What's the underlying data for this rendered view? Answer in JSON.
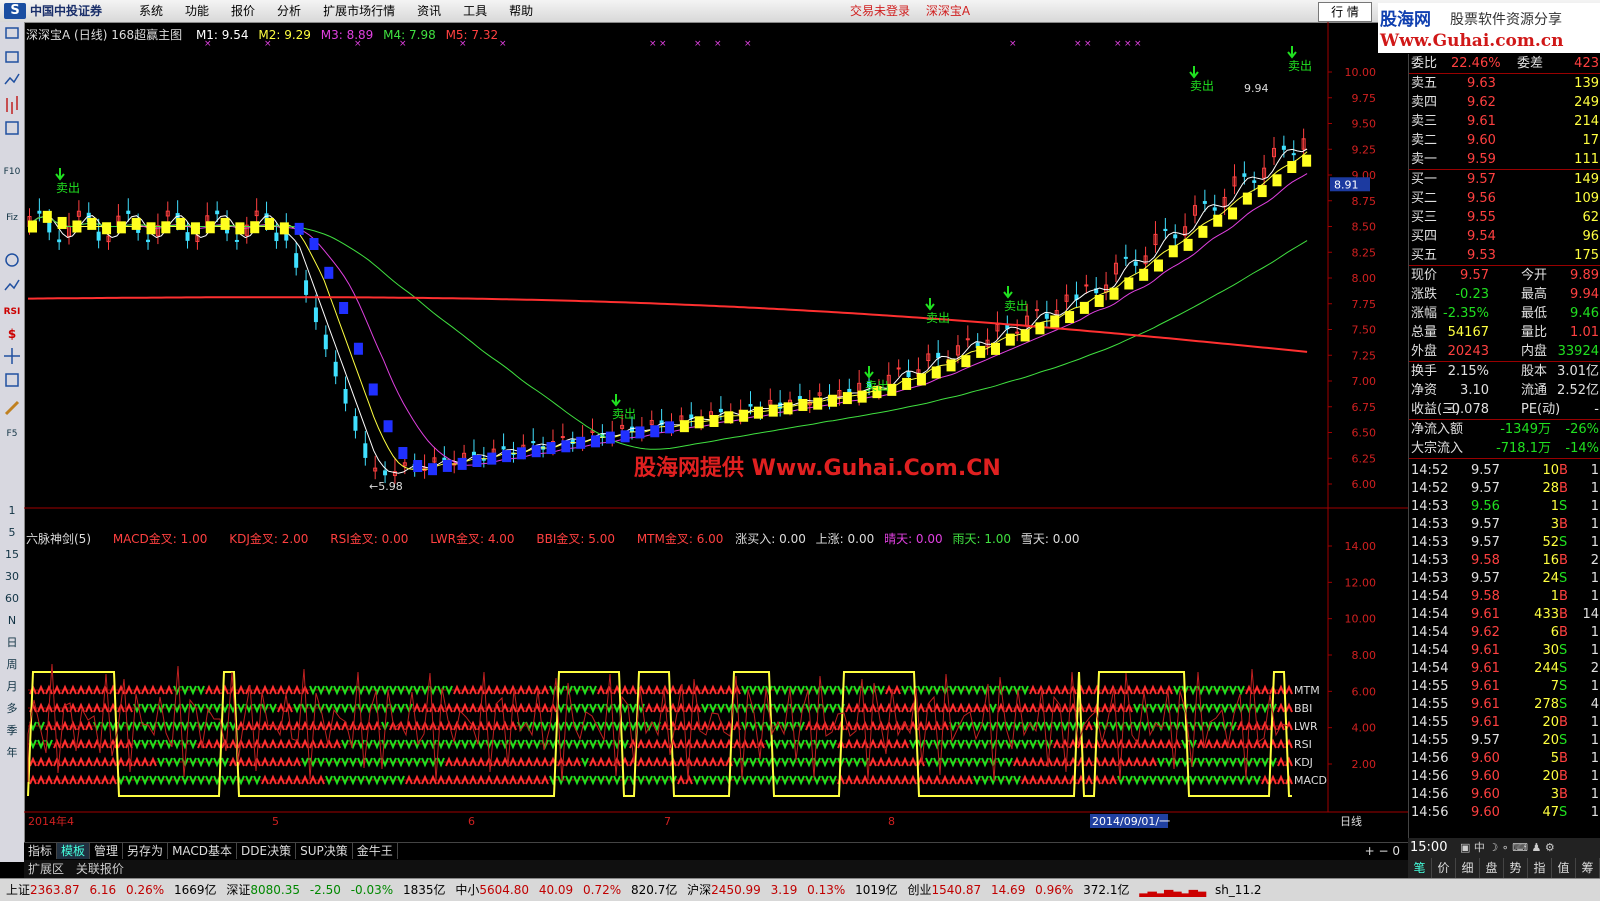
{
  "app": {
    "logo_name": "中国中投证券",
    "menu": [
      "系统",
      "功能",
      "报价",
      "分析",
      "扩展市场行情",
      "资讯",
      "工具",
      "帮助"
    ],
    "login_status": "交易未登录",
    "stock_name": "深深宝A",
    "market_button": "行 情",
    "brand_line1": "股海网",
    "brand_line2": "股票软件资源分享",
    "brand_line3": "Www.Guhai.com.cn"
  },
  "toolbar": {
    "items": [
      "1",
      "5",
      "15",
      "30",
      "60",
      "N",
      "日",
      "周",
      "月",
      "多",
      "季",
      "年"
    ]
  },
  "chart_header": {
    "title": "深深宝A (日线) 168超赢主图",
    "m1": "M1: 9.54",
    "m2": "M2: 9.29",
    "m3": "M3: 8.89",
    "m4": "M4: 7.98",
    "m5": "M5: 7.32"
  },
  "indicator_header": {
    "name": "六脉神剑(5)",
    "items": [
      "MACD金叉: 1.00",
      "KDJ金叉: 2.00",
      "RSI金叉: 0.00",
      "LWR金叉: 4.00",
      "BBI金叉: 5.00",
      "MTM金叉: 6.00"
    ],
    "extra": [
      "涨买入: 0.00",
      "上涨: 0.00",
      "晴天: 0.00",
      "雨天: 1.00",
      "雪天: 0.00"
    ]
  },
  "watermark": "股海网提供 Www.Guhai.Com.CN",
  "chart_data": {
    "type": "line",
    "price_axis": [
      "10.00",
      "9.75",
      "9.50",
      "9.25",
      "9.00",
      "8.75",
      "8.50",
      "8.25",
      "8.00",
      "7.75",
      "7.50",
      "7.25",
      "7.00",
      "6.75",
      "6.50",
      "6.25",
      "6.00"
    ],
    "ind_axis": [
      "14.00",
      "12.00",
      "10.00",
      "8.00",
      "6.00",
      "4.00",
      "2.00"
    ],
    "ind_labels": [
      "MTM",
      "BBI",
      "LWR",
      "RSI",
      "KDJ",
      "MACD"
    ],
    "price_marker": "8.91",
    "high_label": "9.94",
    "low_label": "5.98",
    "sell_label": "卖出",
    "date_axis": [
      "2014年4",
      "5",
      "6",
      "7",
      "8",
      "2014/09/01/一",
      "日线"
    ]
  },
  "bottom_tabs": [
    "指标",
    "模板",
    "管理",
    "另存为",
    "MACD基本",
    "DDE决策",
    "SUP决策",
    "金牛王"
  ],
  "ext_tabs": [
    "扩展区",
    "关联报价"
  ],
  "quote_panel": {
    "header_row": {
      "l1": "委比",
      "v1": "22.46%",
      "l2": "委差",
      "v2": "423"
    },
    "asks": [
      {
        "label": "卖五",
        "price": "9.63",
        "vol": "139"
      },
      {
        "label": "卖四",
        "price": "9.62",
        "vol": "249"
      },
      {
        "label": "卖三",
        "price": "9.61",
        "vol": "214"
      },
      {
        "label": "卖二",
        "price": "9.60",
        "vol": "17"
      },
      {
        "label": "卖一",
        "price": "9.59",
        "vol": "111"
      }
    ],
    "bids": [
      {
        "label": "买一",
        "price": "9.57",
        "vol": "149"
      },
      {
        "label": "买二",
        "price": "9.56",
        "vol": "109"
      },
      {
        "label": "买三",
        "price": "9.55",
        "vol": "62"
      },
      {
        "label": "买四",
        "price": "9.54",
        "vol": "96"
      },
      {
        "label": "买五",
        "price": "9.53",
        "vol": "175"
      }
    ],
    "stats": [
      {
        "l1": "现价",
        "v1": "9.57",
        "l2": "今开",
        "v2": "9.89"
      },
      {
        "l1": "涨跌",
        "v1": "-0.23",
        "l2": "最高",
        "v2": "9.94"
      },
      {
        "l1": "涨幅",
        "v1": "-2.35%",
        "l2": "最低",
        "v2": "9.46"
      },
      {
        "l1": "总量",
        "v1": "54167",
        "l2": "量比",
        "v2": "1.01"
      },
      {
        "l1": "外盘",
        "v1": "20243",
        "l2": "内盘",
        "v2": "33924"
      }
    ],
    "stats2": [
      {
        "l1": "换手",
        "v1": "2.15%",
        "l2": "股本",
        "v2": "3.01亿"
      },
      {
        "l1": "净资",
        "v1": "3.10",
        "l2": "流通",
        "v2": "2.52亿"
      },
      {
        "l1": "收益(三)",
        "v1": "-0.078",
        "l2": "PE(动)",
        "v2": "-"
      }
    ],
    "flows": [
      {
        "label": "净流入额",
        "v1": "-1349万",
        "v2": "-26%"
      },
      {
        "label": "大宗流入",
        "v1": "-718.1万",
        "v2": "-14%"
      }
    ],
    "ticks": [
      {
        "t": "14:52",
        "p": "9.57",
        "v": "10",
        "s": "B",
        "n": "1"
      },
      {
        "t": "14:52",
        "p": "9.57",
        "v": "28",
        "s": "B",
        "n": "1"
      },
      {
        "t": "14:53",
        "p": "9.56",
        "v": "1",
        "s": "S",
        "n": "1"
      },
      {
        "t": "14:53",
        "p": "9.57",
        "v": "3",
        "s": "B",
        "n": "1"
      },
      {
        "t": "14:53",
        "p": "9.57",
        "v": "52",
        "s": "S",
        "n": "1"
      },
      {
        "t": "14:53",
        "p": "9.58",
        "v": "16",
        "s": "B",
        "n": "2"
      },
      {
        "t": "14:53",
        "p": "9.57",
        "v": "24",
        "s": "S",
        "n": "1"
      },
      {
        "t": "14:54",
        "p": "9.58",
        "v": "1",
        "s": "B",
        "n": "1"
      },
      {
        "t": "14:54",
        "p": "9.61",
        "v": "433",
        "s": "B",
        "n": "14"
      },
      {
        "t": "14:54",
        "p": "9.62",
        "v": "6",
        "s": "B",
        "n": "1"
      },
      {
        "t": "14:54",
        "p": "9.61",
        "v": "30",
        "s": "S",
        "n": "1"
      },
      {
        "t": "14:54",
        "p": "9.61",
        "v": "244",
        "s": "S",
        "n": "2"
      },
      {
        "t": "14:55",
        "p": "9.61",
        "v": "7",
        "s": "S",
        "n": "1"
      },
      {
        "t": "14:55",
        "p": "9.61",
        "v": "278",
        "s": "S",
        "n": "4"
      },
      {
        "t": "14:55",
        "p": "9.61",
        "v": "20",
        "s": "B",
        "n": "1"
      },
      {
        "t": "14:55",
        "p": "9.57",
        "v": "20",
        "s": "S",
        "n": "1"
      },
      {
        "t": "14:56",
        "p": "9.60",
        "v": "5",
        "s": "B",
        "n": "1"
      },
      {
        "t": "14:56",
        "p": "9.60",
        "v": "20",
        "s": "B",
        "n": "1"
      },
      {
        "t": "14:56",
        "p": "9.60",
        "v": "3",
        "s": "B",
        "n": "1"
      },
      {
        "t": "14:56",
        "p": "9.60",
        "v": "47",
        "s": "S",
        "n": "1"
      },
      {
        "t": "15:00",
        "p": "",
        "v": "",
        "s": "",
        "n": ""
      }
    ],
    "bottom_tabs": [
      "笔",
      "价",
      "细",
      "盘",
      "势",
      "指",
      "值",
      "筹"
    ]
  },
  "statusbar": {
    "sh": {
      "name": "上证",
      "val": "2363.87",
      "chg": "6.16",
      "pct": "0.26%",
      "amt": "1669亿"
    },
    "sz": {
      "name": "深证",
      "val": "8080.35",
      "chg": "-2.50",
      "pct": "-0.03%",
      "amt": "1835亿"
    },
    "zx": {
      "name": "中小",
      "val": "5604.80",
      "chg": "40.09",
      "pct": "0.72%",
      "amt": "820.7亿"
    },
    "hs": {
      "name": "沪深",
      "val": "2450.99",
      "chg": "3.19",
      "pct": "0.13%",
      "amt": "1019亿"
    },
    "cy": {
      "name": "创业",
      "val": "1540.87",
      "chg": "14.69",
      "pct": "0.96%",
      "amt": "372.1亿"
    },
    "tail": "sh_11.2"
  }
}
